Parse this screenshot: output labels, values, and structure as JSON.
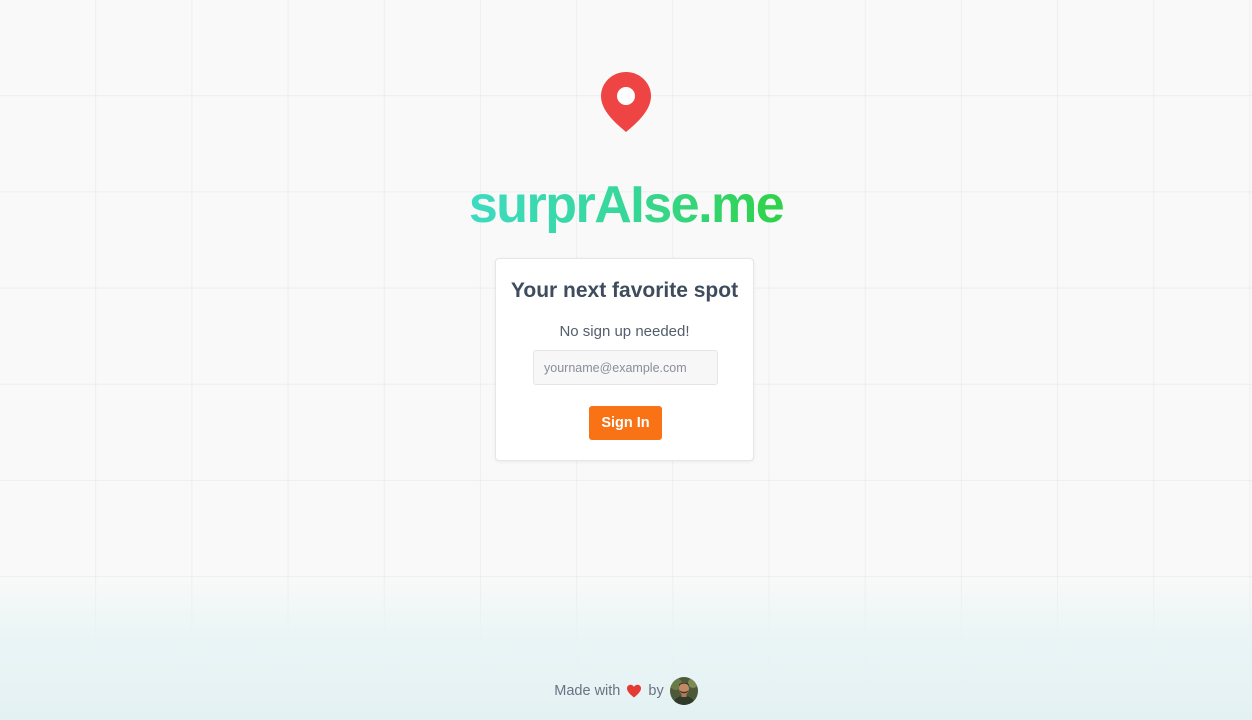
{
  "brand": {
    "name": "surprAIse.me",
    "gradient_start": "#3ddbc1",
    "gradient_end": "#2fd247",
    "logo_icon": "map-pin-icon",
    "logo_color": "#ef4444"
  },
  "login_card": {
    "title": "Your next favorite spot",
    "subtitle": "No sign up needed!",
    "email_placeholder": "yourname@example.com",
    "email_value": "",
    "submit_label": "Sign In",
    "submit_color": "#f97316"
  },
  "footer": {
    "made_with": "Made with",
    "heart_icon": "heart-icon",
    "by": "by",
    "avatar_icon": "avatar"
  }
}
